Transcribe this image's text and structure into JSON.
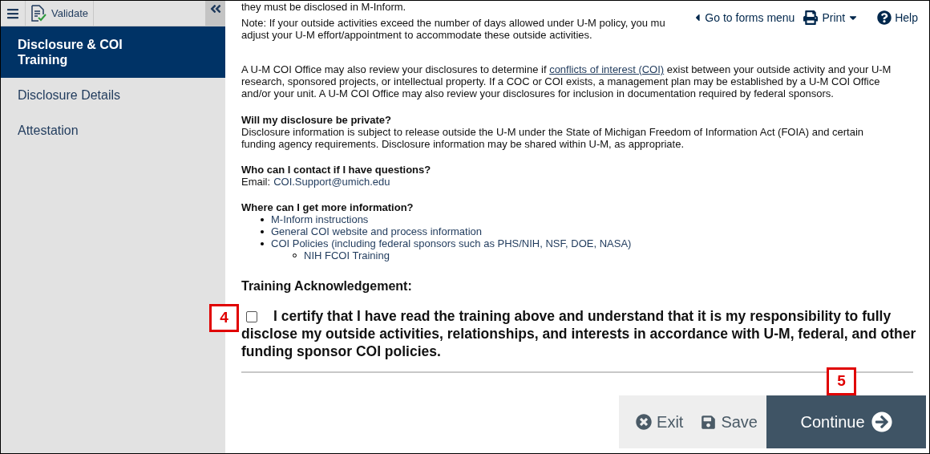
{
  "toolbar": {
    "validate_label": "Validate"
  },
  "sidebar": {
    "items": [
      {
        "label": "Disclosure & COI Training",
        "selected": true
      },
      {
        "label": "Disclosure Details",
        "selected": false
      },
      {
        "label": "Attestation",
        "selected": false
      }
    ]
  },
  "top_links": [
    {
      "kind": "back",
      "label": "Go to forms menu"
    },
    {
      "kind": "print",
      "label": "Print"
    },
    {
      "kind": "help",
      "label": "Help"
    }
  ],
  "content": {
    "cut_line": "they must be disclosed in M-Inform.",
    "note_lines": [
      "Note:  If your outside activities exceed the number of days allowed under U-M policy, you mu",
      "adjust your U-M effort/appointment to accommodate these outside activities."
    ],
    "coi_paragraph": {
      "before": "A U-M COI Office may also review your disclosures to determine if",
      "link": "conflicts of interest (COI)",
      "after": "exist between your outside activity and your U-M research, sponsored projects, or intellectual property. If a COC or COI exists, a management plan may be established by a U-M COI Office and/or your unit.  A U-M COI Office may also review your disclosures for inclusion in documentation required by federal sponsors."
    },
    "privacy": {
      "heading": "Will my disclosure be private?",
      "text": "Disclosure information is subject to release outside the U-M under the State of Michigan Freedom of Information Act (FOIA) and certain funding agency requirements. Disclosure information may be shared within U-M, as appropriate."
    },
    "contact": {
      "heading": "Who can I contact if I have questions?",
      "label": "Email:",
      "email": "COI.Support@umich.edu"
    },
    "more_info": {
      "heading": "Where can I get more information?",
      "links": [
        {
          "label": "M-Inform instructions"
        },
        {
          "label": "General COI website and process information"
        },
        {
          "label": "COI Policies (including federal sponsors such as PHS/NIH, NSF, DOE, NASA)",
          "children": [
            {
              "label": "NIH FCOI Training"
            }
          ]
        }
      ]
    }
  },
  "acknowledgement": {
    "heading": "Training Acknowledgement:",
    "checked": false,
    "text": "I certify that I have read the training above and understand that it is my responsibility to fully disclose my outside activities, relationships, and interests in accordance with U-M, federal, and other funding sponsor COI policies."
  },
  "buttons": [
    {
      "kind": "exit",
      "label": "Exit"
    },
    {
      "kind": "save",
      "label": "Save"
    },
    {
      "kind": "continue",
      "label": "Continue"
    }
  ],
  "callouts": [
    "4",
    "5"
  ]
}
